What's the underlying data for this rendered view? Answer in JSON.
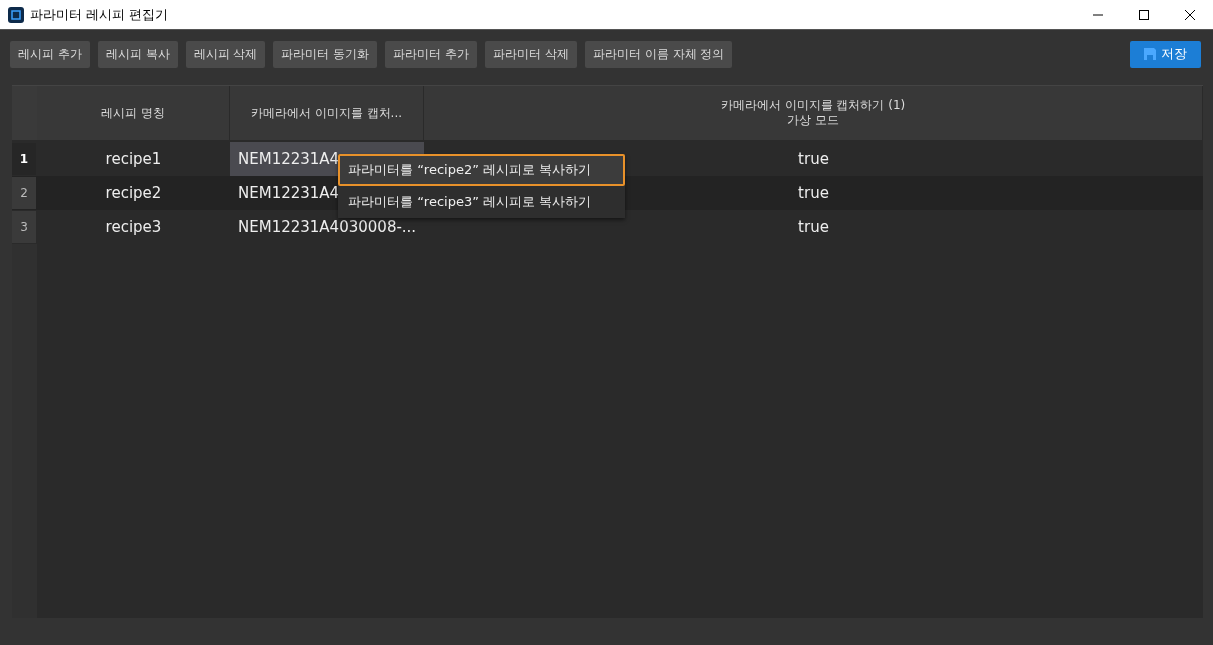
{
  "window": {
    "title": "파라미터 레시피 편집기"
  },
  "toolbar": {
    "buttons": [
      "레시피 추가",
      "레시피 복사",
      "레시피 삭제",
      "파라미터 동기화",
      "파라미터 추가",
      "파라미터 삭제",
      "파라미터 이름 자체 정의"
    ],
    "save": "저장"
  },
  "table": {
    "columns": [
      "레시피 명칭",
      "카메라에서 이미지를 캡처...",
      [
        "카메라에서 이미지를 캡처하기 (1)",
        "가상 모드"
      ]
    ],
    "rows": [
      {
        "number": "1",
        "selected": true,
        "cells": [
          {
            "text": "recipe1",
            "selected": false
          },
          {
            "text": "NEM12231A4",
            "selected": true
          },
          {
            "text": "true",
            "selected": false
          }
        ]
      },
      {
        "number": "2",
        "selected": false,
        "cells": [
          {
            "text": "recipe2",
            "selected": false
          },
          {
            "text": "NEM12231A4",
            "selected": false
          },
          {
            "text": "true",
            "selected": false
          }
        ]
      },
      {
        "number": "3",
        "selected": false,
        "cells": [
          {
            "text": "recipe3",
            "selected": false
          },
          {
            "text": "NEM12231A4030008-...",
            "selected": false
          },
          {
            "text": "true",
            "selected": false
          }
        ]
      }
    ]
  },
  "context_menu": {
    "items": [
      {
        "label": "파라미터를 “recipe2” 레시피로 복사하기",
        "selected": true
      },
      {
        "label": "파라미터를 “recipe3” 레시피로 복사하기",
        "selected": false
      }
    ]
  }
}
